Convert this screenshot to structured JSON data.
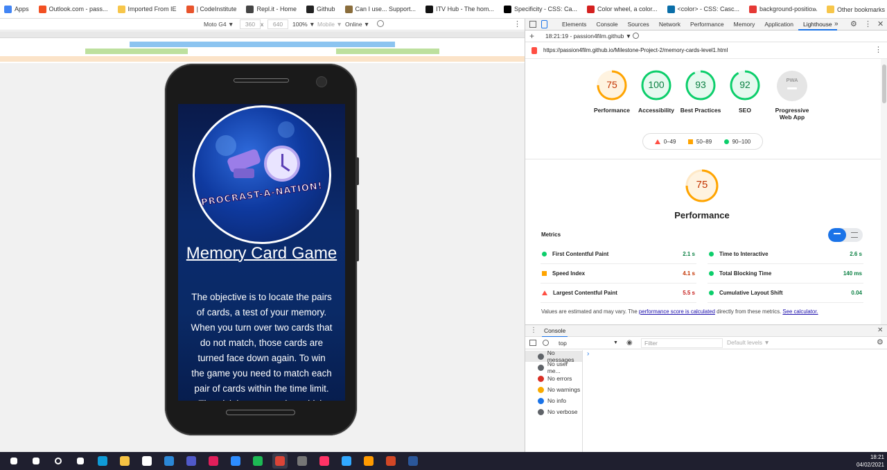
{
  "bookmarks": [
    {
      "label": "Apps",
      "icon": "apps-grid-icon",
      "color": "#4285f4"
    },
    {
      "label": "Outlook.com - pass...",
      "icon": "microsoft-logo-icon",
      "color": "#f25022"
    },
    {
      "label": "Imported From IE",
      "icon": "folder-icon",
      "color": "#f7c64a"
    },
    {
      "label": "| CodeInstitute",
      "icon": "codeinstitute-icon",
      "color": "#e8542c"
    },
    {
      "label": "Repl.it - Home",
      "icon": "replit-icon",
      "color": "#444444"
    },
    {
      "label": "Github",
      "icon": "github-icon",
      "color": "#222222"
    },
    {
      "label": "Can I use... Support...",
      "icon": "caniuse-icon",
      "color": "#8a6d3b"
    },
    {
      "label": "ITV Hub - The hom...",
      "icon": "itv-icon",
      "color": "#111111"
    },
    {
      "label": "Specificity - CSS: Ca...",
      "icon": "mdn-icon",
      "color": "#000000"
    },
    {
      "label": "Color wheel, a color...",
      "icon": "adobe-color-icon",
      "color": "#d4201f"
    },
    {
      "label": "<color> - CSS: Casc...",
      "icon": "mdn-icon",
      "color": "#0a6ea8"
    },
    {
      "label": "background-positio...",
      "icon": "star-icon",
      "color": "#e53935"
    }
  ],
  "bookmarks_more": "»",
  "other_bookmarks": "Other bookmarks",
  "device_toolbar": {
    "device": "Moto G4 ▼",
    "width": "360",
    "times": "x",
    "height": "640",
    "zoom": "100% ▼",
    "mode": "Mobile ▼",
    "network": "Online ▼"
  },
  "phone_screen": {
    "logo_text": "PROCRAST-A-NATION!",
    "title": "Memory Card Game",
    "body": "The objective is to locate the pairs of cards, a test of your memory. When you turn over two cards that do not match, those cards are turned face down again. To win the game you need to match each pair of cards within the time limit. The trick is to remember which"
  },
  "devtools": {
    "tabs": [
      "Elements",
      "Console",
      "Sources",
      "Network",
      "Performance",
      "Memory",
      "Application",
      "Lighthouse"
    ],
    "active_tab": "Lighthouse",
    "more": "»",
    "report_time": "18:21:19 - passion4film.github ▼",
    "url": "https://passion4film.github.io/Milestone-Project-2/memory-cards-level1.html",
    "scores": [
      {
        "label": "Performance",
        "value": "75",
        "color": "#ffa400",
        "bg": "#fff3e0",
        "fraction": 0.75
      },
      {
        "label": "Accessibility",
        "value": "100",
        "color": "#0cce6b",
        "bg": "#e6f9ef",
        "fraction": 1.0
      },
      {
        "label": "Best Practices",
        "value": "93",
        "color": "#0cce6b",
        "bg": "#e6f9ef",
        "fraction": 0.93
      },
      {
        "label": "SEO",
        "value": "92",
        "color": "#0cce6b",
        "bg": "#e6f9ef",
        "fraction": 0.92
      }
    ],
    "pwa": {
      "badge": "PWA",
      "label_line1": "Progressive",
      "label_line2": "Web App"
    },
    "legend": [
      {
        "range": "0–49",
        "color": "#ff4e42"
      },
      {
        "range": "50–89",
        "color": "#ffa400"
      },
      {
        "range": "90–100",
        "color": "#0cce6b"
      }
    ],
    "perf_section": {
      "score": "75",
      "title": "Performance",
      "metrics_label": "Metrics"
    },
    "metrics": [
      {
        "name": "First Contentful Paint",
        "value": "2.1 s",
        "status": "good",
        "color": "#0cce6b",
        "vcolor": "#0b8043"
      },
      {
        "name": "Time to Interactive",
        "value": "2.6 s",
        "status": "good",
        "color": "#0cce6b",
        "vcolor": "#0b8043"
      },
      {
        "name": "Speed Index",
        "value": "4.1 s",
        "status": "average",
        "color": "#ffa400",
        "vcolor": "#c33300"
      },
      {
        "name": "Total Blocking Time",
        "value": "140 ms",
        "status": "good",
        "color": "#0cce6b",
        "vcolor": "#0b8043"
      },
      {
        "name": "Largest Contentful Paint",
        "value": "5.5 s",
        "status": "poor",
        "color": "#ff4e42",
        "vcolor": "#c7221f"
      },
      {
        "name": "Cumulative Layout Shift",
        "value": "0.04",
        "status": "good",
        "color": "#0cce6b",
        "vcolor": "#0b8043"
      }
    ],
    "footnote": {
      "before": "Values are estimated and may vary. The ",
      "link1": "performance score is calculated",
      "middle": " directly from these metrics. ",
      "link2": "See calculator."
    }
  },
  "console_drawer": {
    "tab": "Console",
    "context": "top",
    "filter_placeholder": "Filter",
    "levels": "Default levels ▼",
    "prompt": "›",
    "items": [
      {
        "label": "No messages",
        "icon": "list-icon",
        "color": "#5f6368"
      },
      {
        "label": "No user me...",
        "icon": "user-icon",
        "color": "#5f6368"
      },
      {
        "label": "No errors",
        "icon": "error-icon",
        "color": "#d93025"
      },
      {
        "label": "No warnings",
        "icon": "warning-icon",
        "color": "#f9ab00"
      },
      {
        "label": "No info",
        "icon": "info-icon",
        "color": "#1a73e8"
      },
      {
        "label": "No verbose",
        "icon": "verbose-icon",
        "color": "#5f6368"
      }
    ]
  },
  "taskbar": {
    "time": "18:21",
    "date": "04/02/2021",
    "apps": [
      {
        "icon": "windows-start-icon",
        "color": "#ffffff"
      },
      {
        "icon": "search-icon",
        "color": "#ffffff"
      },
      {
        "icon": "cortana-icon",
        "color": "#ffffff"
      },
      {
        "icon": "task-view-icon",
        "color": "#ffffff"
      },
      {
        "icon": "edge-icon",
        "color": "#0f9bd7"
      },
      {
        "icon": "file-explorer-icon",
        "color": "#f6c344"
      },
      {
        "icon": "store-icon",
        "color": "#ffffff"
      },
      {
        "icon": "mail-icon",
        "color": "#2b88d8"
      },
      {
        "icon": "teams-icon",
        "color": "#5059c9"
      },
      {
        "icon": "slack-icon",
        "color": "#e01e5a"
      },
      {
        "icon": "zoom-icon",
        "color": "#2d8cff"
      },
      {
        "icon": "spotify-icon",
        "color": "#1db954"
      },
      {
        "icon": "chrome-icon",
        "color": "#db4437"
      },
      {
        "icon": "calculator-icon",
        "color": "#767676"
      },
      {
        "icon": "indesign-icon",
        "color": "#ff3366"
      },
      {
        "icon": "photoshop-icon",
        "color": "#31a8ff"
      },
      {
        "icon": "illustrator-icon",
        "color": "#ff9a00"
      },
      {
        "icon": "powerpoint-icon",
        "color": "#d24726"
      },
      {
        "icon": "word-icon",
        "color": "#2b579a"
      }
    ]
  }
}
